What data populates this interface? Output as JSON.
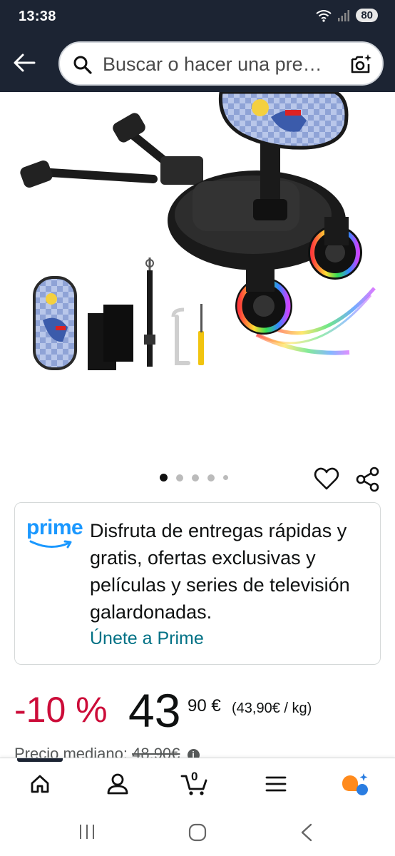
{
  "status_bar": {
    "time": "13:38",
    "battery": "80",
    "icons": [
      "wifi-icon",
      "signal-icon"
    ]
  },
  "search": {
    "placeholder": "Buscar o hacer una pre…",
    "icons": [
      "search-icon",
      "camera-search-icon"
    ]
  },
  "product": {
    "image_alt": "product-image",
    "carousel": {
      "total": 5,
      "active_index": 0
    }
  },
  "prime": {
    "logo_text": "prime",
    "description": "Disfruta de entregas rápidas y gratis, ofertas exclusivas y películas y series de televisión galardonadas.",
    "link_label": "Únete a Prime",
    "color": "#1a98ff"
  },
  "price": {
    "discount": "-10 %",
    "integer": "43",
    "fraction": "90 €",
    "unit_price": "(43,90€ / kg)",
    "median_label": "Precio mediano:",
    "median_value": "48,90€",
    "discount_color": "#cc0c39"
  },
  "bottom_nav": {
    "items": [
      "home-icon",
      "account-icon",
      "cart-icon",
      "menu-icon",
      "rufus-icon"
    ],
    "cart_count": "0"
  }
}
